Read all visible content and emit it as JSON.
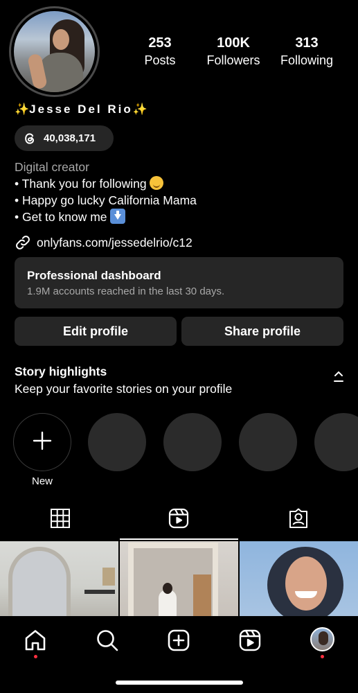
{
  "profile": {
    "name_sparkle_left": "✨",
    "name": "Jesse Del Rio",
    "name_sparkle_right": "✨",
    "threads_count": "40,038,171",
    "category": "Digital creator",
    "bio_lines": [
      "• Thank you for following",
      "• Happy go lucky California Mama",
      "• Get to know me"
    ],
    "link": "onlyfans.com/jessedelrio/c12"
  },
  "stats": {
    "posts": {
      "value": "253",
      "label": "Posts"
    },
    "followers": {
      "value": "100K",
      "label": "Followers"
    },
    "following": {
      "value": "313",
      "label": "Following"
    }
  },
  "dashboard": {
    "title": "Professional dashboard",
    "subtitle": "1.9M accounts reached in the last 30 days."
  },
  "buttons": {
    "edit": "Edit profile",
    "share": "Share profile"
  },
  "highlights": {
    "title": "Story highlights",
    "subtitle": "Keep your favorite stories on your profile",
    "new_label": "New"
  },
  "tabs": {
    "active": "reels"
  },
  "nav": {
    "active": "home"
  },
  "colors": {
    "background": "#000000",
    "surface": "#262626",
    "secondary_text": "#a8a8a8",
    "notification_dot": "#ff3040",
    "sparkle": "#f5c842"
  }
}
